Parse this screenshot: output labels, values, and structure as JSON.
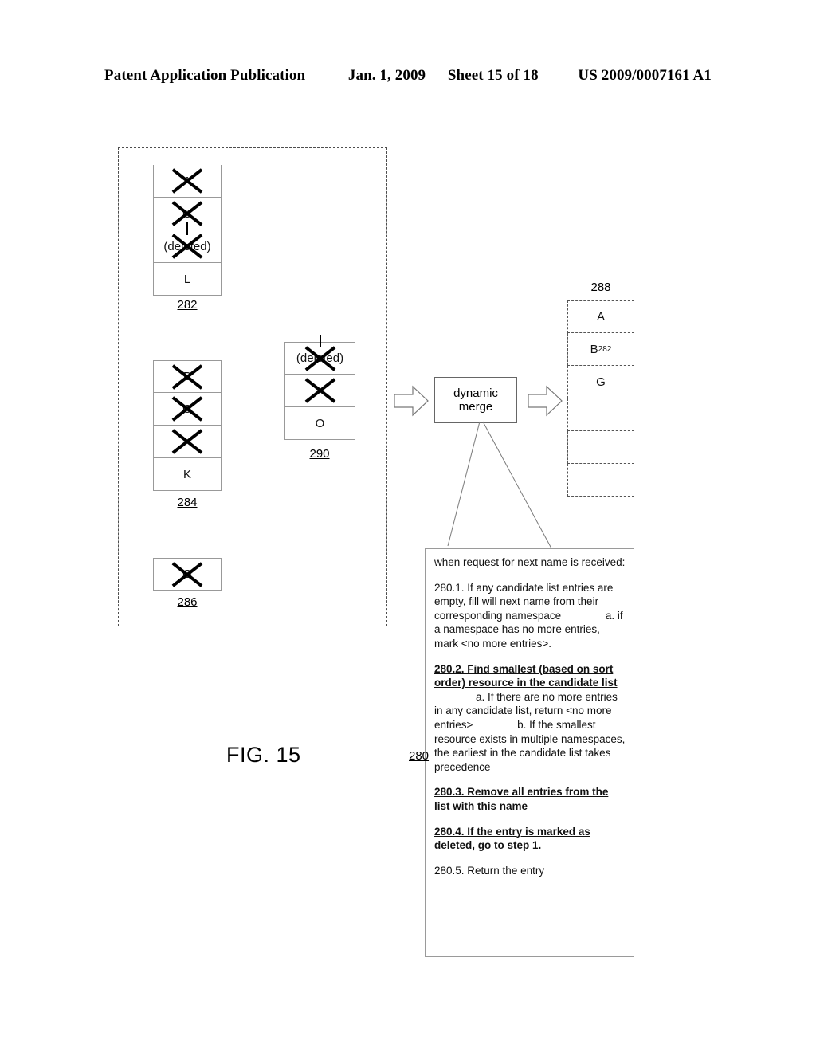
{
  "header": {
    "publication": "Patent Application Publication",
    "date": "Jan. 1, 2009",
    "sheet": "Sheet 15 of 18",
    "patent_number": "US 2009/0007161 A1"
  },
  "figure": {
    "label": "FIG. 15",
    "reference": "280"
  },
  "diagram": {
    "namespace_boxes": [
      {
        "id": "282",
        "label": "282",
        "rows": [
          {
            "text": "A",
            "struck": true,
            "deleted_tick": false
          },
          {
            "text": "G",
            "struck": true,
            "deleted_tick": false
          },
          {
            "text": "(deleted)",
            "struck": true,
            "deleted_tick": true
          },
          {
            "text": "L",
            "struck": false,
            "deleted_tick": false
          }
        ]
      },
      {
        "id": "284",
        "label": "284",
        "rows": [
          {
            "text": "B",
            "struck": true,
            "deleted_tick": false
          },
          {
            "text": "G",
            "struck": true,
            "deleted_tick": false
          },
          {
            "text": "",
            "struck": true,
            "deleted_tick": false
          },
          {
            "text": "K",
            "struck": false,
            "deleted_tick": false
          }
        ]
      },
      {
        "id": "286",
        "label": "286",
        "rows": [
          {
            "text": "G",
            "struck": true,
            "deleted_tick": false
          }
        ]
      },
      {
        "id": "290",
        "label": "290",
        "rows": [
          {
            "text": "(deleted)",
            "struck": true,
            "deleted_tick": true
          },
          {
            "text": "",
            "struck": true,
            "deleted_tick": false
          },
          {
            "text": "O",
            "struck": false,
            "deleted_tick": false
          }
        ]
      }
    ],
    "merge": {
      "line1": "dynamic",
      "line2": "merge"
    },
    "candidate_list": {
      "id": "288",
      "label": "288",
      "rows": [
        {
          "text": "A",
          "subscript": ""
        },
        {
          "text": "B",
          "subscript": "282"
        },
        {
          "text": "G",
          "subscript": ""
        },
        {
          "text": "",
          "subscript": ""
        },
        {
          "text": "",
          "subscript": ""
        },
        {
          "text": "",
          "subscript": ""
        }
      ]
    }
  },
  "algorithm": {
    "intro": "when request for next name is received:",
    "steps": [
      {
        "bold": false,
        "text": "280.1.  If any candidate list entries are empty, fill will next name from their corresponding namespace",
        "sub": "a.  if a namespace has no more entries, mark <no more entries>."
      },
      {
        "bold": true,
        "text": "280.2.  Find smallest (based on sort order) resource in the candidate list",
        "sub_a": "a.  If there are no more entries in any candidate list, return <no more entries>",
        "sub_b": "b.  If the smallest resource exists in multiple namespaces, the earliest in the candidate list takes precedence"
      },
      {
        "bold": true,
        "text": "280.3.  Remove all entries from the list with this name"
      },
      {
        "bold": true,
        "text": "280.4.  If the entry is marked as deleted, go to step 1."
      },
      {
        "bold": false,
        "text": "280.5.  Return the entry"
      }
    ]
  },
  "colors": {
    "ink": "#000000",
    "rule": "#999999",
    "dashed": "#4d4d4d",
    "panel_border": "#9a9a9a"
  }
}
